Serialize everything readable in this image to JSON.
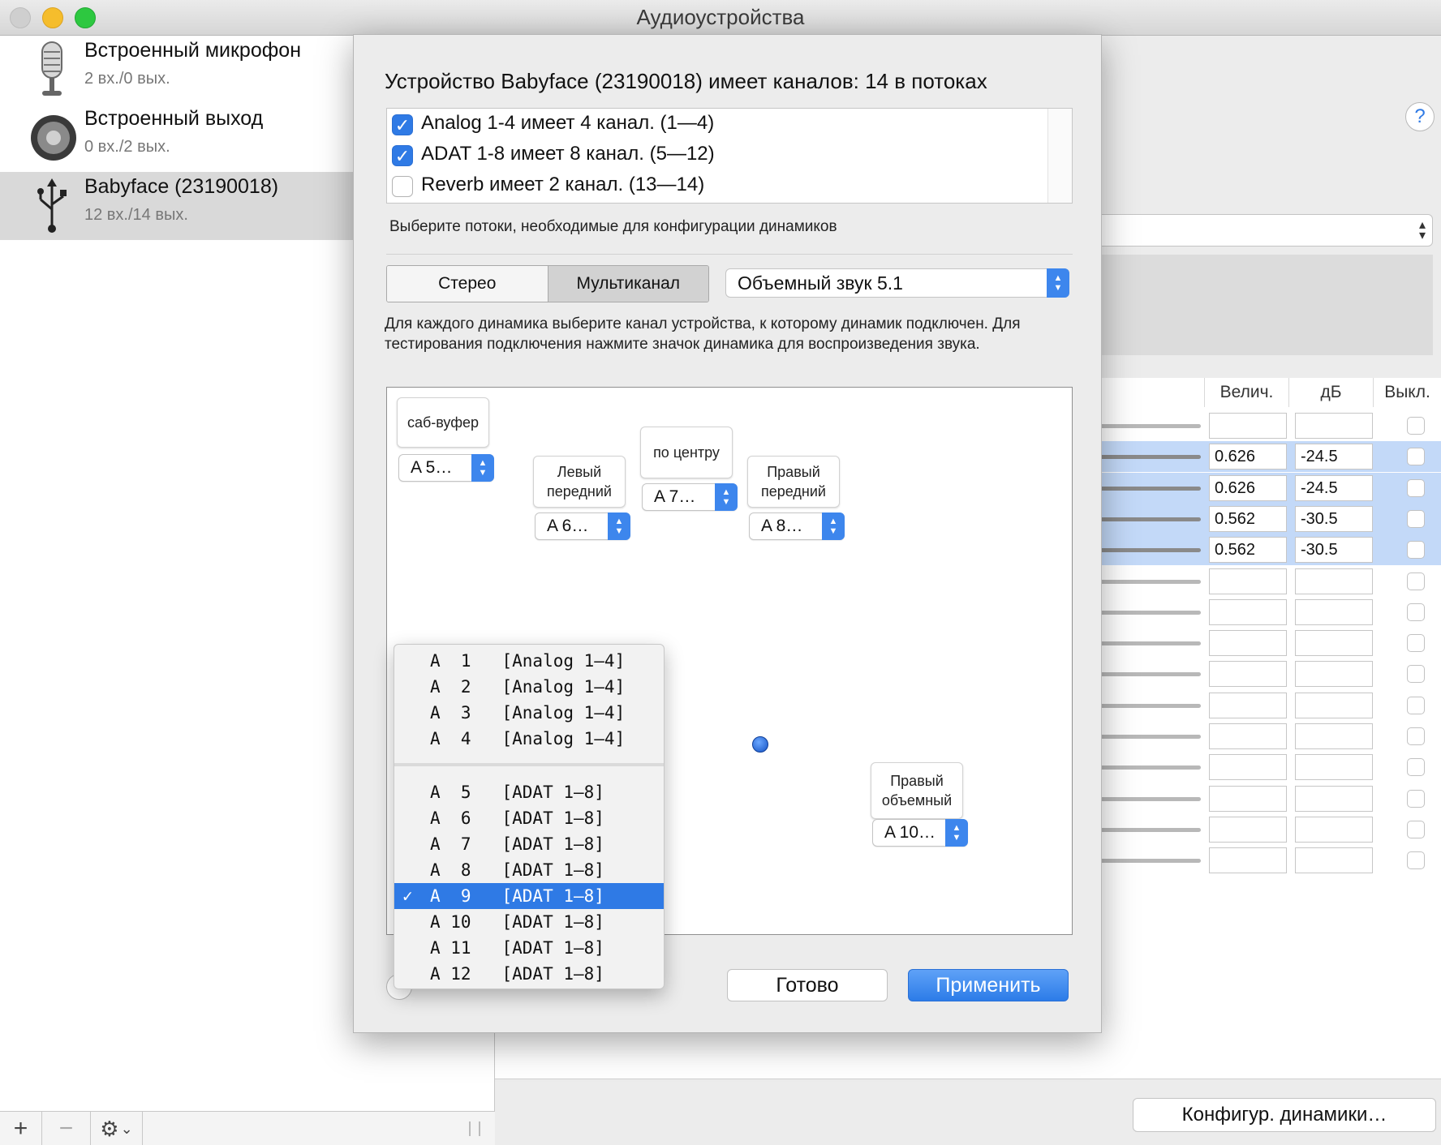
{
  "window": {
    "title": "Аудиоустройства"
  },
  "sidebar": {
    "devices": [
      {
        "name": "Встроенный микрофон",
        "io": "2 вх./0 вых.",
        "icon": "microphone-icon"
      },
      {
        "name": "Встроенный выход",
        "io": "0 вх./2 вых.",
        "icon": "speaker-icon"
      },
      {
        "name": "Babyface (23190018)",
        "io": "12 вх./14 вых.",
        "icon": "usb-icon",
        "selected": true
      }
    ],
    "bottom": {
      "add": "+",
      "remove": "−",
      "gear": "⚙",
      "chevron": "⌄"
    }
  },
  "right_panel": {
    "help": "?",
    "columns": {
      "value": "Велич.",
      "db": "дБ",
      "mute": "Выкл."
    },
    "rows": [
      {
        "value": "",
        "db": "",
        "highlight": false
      },
      {
        "value": "0.626",
        "db": "-24.5",
        "highlight": true
      },
      {
        "value": "0.626",
        "db": "-24.5",
        "highlight": true
      },
      {
        "value": "0.562",
        "db": "-30.5",
        "highlight": true
      },
      {
        "value": "0.562",
        "db": "-30.5",
        "highlight": true
      },
      {
        "value": "",
        "db": "",
        "highlight": false
      },
      {
        "value": "",
        "db": "",
        "highlight": false
      },
      {
        "value": "",
        "db": "",
        "highlight": false
      },
      {
        "value": "",
        "db": "",
        "highlight": false
      },
      {
        "value": "",
        "db": "",
        "highlight": false
      },
      {
        "value": "",
        "db": "",
        "highlight": false
      },
      {
        "value": "",
        "db": "",
        "highlight": false
      },
      {
        "value": "",
        "db": "",
        "highlight": false
      },
      {
        "value": "",
        "db": "",
        "highlight": false
      },
      {
        "value": "",
        "db": "",
        "highlight": false
      }
    ],
    "configure_button": "Конфигур. динамики…"
  },
  "sheet": {
    "title": "Устройство Babyface (23190018) имеет каналов: 14 в потоках",
    "streams": [
      {
        "label": "Analog 1-4 имеет 4 канал. (1—4)",
        "checked": true
      },
      {
        "label": "ADAT 1-8 имеет 8 канал. (5—12)",
        "checked": true
      },
      {
        "label": "Reverb имеет 2 канал. (13—14)",
        "checked": false
      }
    ],
    "streams_hint": "Выберите потоки, необходимые для конфигурации динамиков",
    "mode_stereo": "Стерео",
    "mode_multi": "Мультиканал",
    "config_value": "Объемный звук 5.1",
    "instructions": "Для каждого динамика выберите канал устройства, к которому динамик подключен. Для тестирования подключения нажмите значок динамика для воспроизведения звука.",
    "speakers": {
      "sub": {
        "label": "саб-вуфер",
        "channel": "A 5…"
      },
      "left_front": {
        "label": "Левый передний",
        "channel": "A 6…"
      },
      "center": {
        "label": "по центру",
        "channel": "A 7…"
      },
      "right_front": {
        "label": "Правый передний",
        "channel": "A 8…"
      },
      "right_surround": {
        "label": "Правый объемный",
        "channel": "A 10…"
      }
    },
    "done": "Готово",
    "apply": "Применить"
  },
  "channel_menu": {
    "items": [
      {
        "text": "A  1   [Analog 1–4]",
        "checked": false
      },
      {
        "text": "A  2   [Analog 1–4]",
        "checked": false
      },
      {
        "text": "A  3   [Analog 1–4]",
        "checked": false
      },
      {
        "text": "A  4   [Analog 1–4]",
        "checked": false
      },
      {
        "text": "A  5   [ADAT 1–8]",
        "checked": false
      },
      {
        "text": "A  6   [ADAT 1–8]",
        "checked": false
      },
      {
        "text": "A  7   [ADAT 1–8]",
        "checked": false
      },
      {
        "text": "A  8   [ADAT 1–8]",
        "checked": false
      },
      {
        "text": "A  9   [ADAT 1–8]",
        "checked": true
      },
      {
        "text": "A 10   [ADAT 1–8]",
        "checked": false
      },
      {
        "text": "A 11   [ADAT 1–8]",
        "checked": false
      },
      {
        "text": "A 12   [ADAT 1–8]",
        "checked": false
      }
    ],
    "check_mark": "✓"
  },
  "colors": {
    "accent": "#2f7ae5",
    "selection_row": "#c3d9f8",
    "sidebar_selected": "#d9d9d9"
  }
}
